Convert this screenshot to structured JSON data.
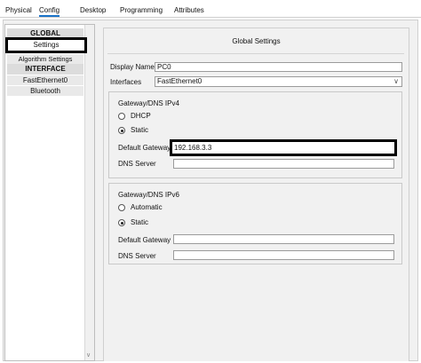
{
  "tabs": [
    {
      "label": "Physical"
    },
    {
      "label": "Config"
    },
    {
      "label": "Desktop"
    },
    {
      "label": "Programming"
    },
    {
      "label": "Attributes"
    }
  ],
  "active_tab": "Config",
  "nav": {
    "header_global": "GLOBAL",
    "item_settings": "Settings",
    "item_algorithm": "Algorithm Settings",
    "header_interface": "INTERFACE",
    "item_fastethernet": "FastEthernet0",
    "item_bluetooth": "Bluetooth"
  },
  "global_settings": {
    "title": "Global Settings",
    "display_name_label": "Display Name",
    "display_name_value": "PC0",
    "interfaces_label": "Interfaces",
    "interfaces_value": "FastEthernet0"
  },
  "ipv4": {
    "title": "Gateway/DNS IPv4",
    "dhcp_label": "DHCP",
    "static_label": "Static",
    "selected": "Static",
    "gateway_label": "Default Gateway",
    "gateway_value": "192.168.3.3",
    "dns_label": "DNS Server",
    "dns_value": ""
  },
  "ipv6": {
    "title": "Gateway/DNS IPv6",
    "automatic_label": "Automatic",
    "static_label": "Static",
    "selected": "Static",
    "gateway_label": "Default Gateway",
    "gateway_value": "",
    "dns_label": "DNS Server",
    "dns_value": ""
  },
  "colors": {
    "active_tab_underline": "#1a73c8",
    "highlight_border": "#000000"
  }
}
